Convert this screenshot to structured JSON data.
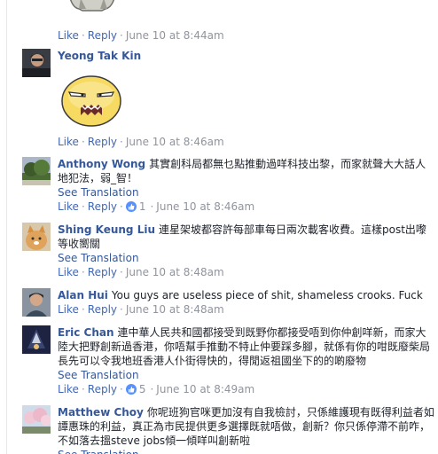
{
  "actions": {
    "like": "Like",
    "reply": "Reply",
    "sep": "·"
  },
  "translation": {
    "see": "See Translation"
  },
  "comments": [
    {
      "time": "June 10 at 8:44am"
    },
    {
      "author": "Yeong Tak Kin",
      "time": "June 10 at 8:46am",
      "sticker": "grumpy-face-sticker"
    },
    {
      "author": "Anthony Wong",
      "text": "其實創科局都無乜點推動過咩科技出黎，而家就聲大大話人地犯法，弱_智！",
      "reactions": "",
      "time": "June 10 at 8:46am",
      "like_count": "1"
    },
    {
      "author": "Shing Keung Liu",
      "text": "連星架坡都容許每部車每日兩次載客收費。這樣post出嚟等收嚮關",
      "time": "June 10 at 8:48am"
    },
    {
      "author": "Alan Hui",
      "text": "You guys are useless piece of shit, shameless crooks. Fuck",
      "time": "June 10 at 8:48am"
    },
    {
      "author": "Eric Chan",
      "text": "連中華人民共和國都接受到既野你都接受唔到你仲創咩新，而家大陸大把野創新過香港，你唔幫手推動不特止仲要踩多腳，就係有你的咁既廢柴局長先可以令我地班香港人仆街得快的，得閒返祖國坐下的的啲廢物",
      "time": "June 10 at 8:49am",
      "like_count": "5"
    },
    {
      "author": "Matthew Choy",
      "text": "你呢班狗官咪更加沒有自我檢討，只係維護現有既得利益者如譚惠珠的利益，真正為市民提供更多選擇既就唔做，創新？你只係停滯不前咋，不如落去搵steve jobs傾一傾咩叫創新啦"
    }
  ],
  "colors": {
    "link": "#4267b2",
    "author": "#365899",
    "meta": "#90949c",
    "like_badge": "#5890ff"
  }
}
